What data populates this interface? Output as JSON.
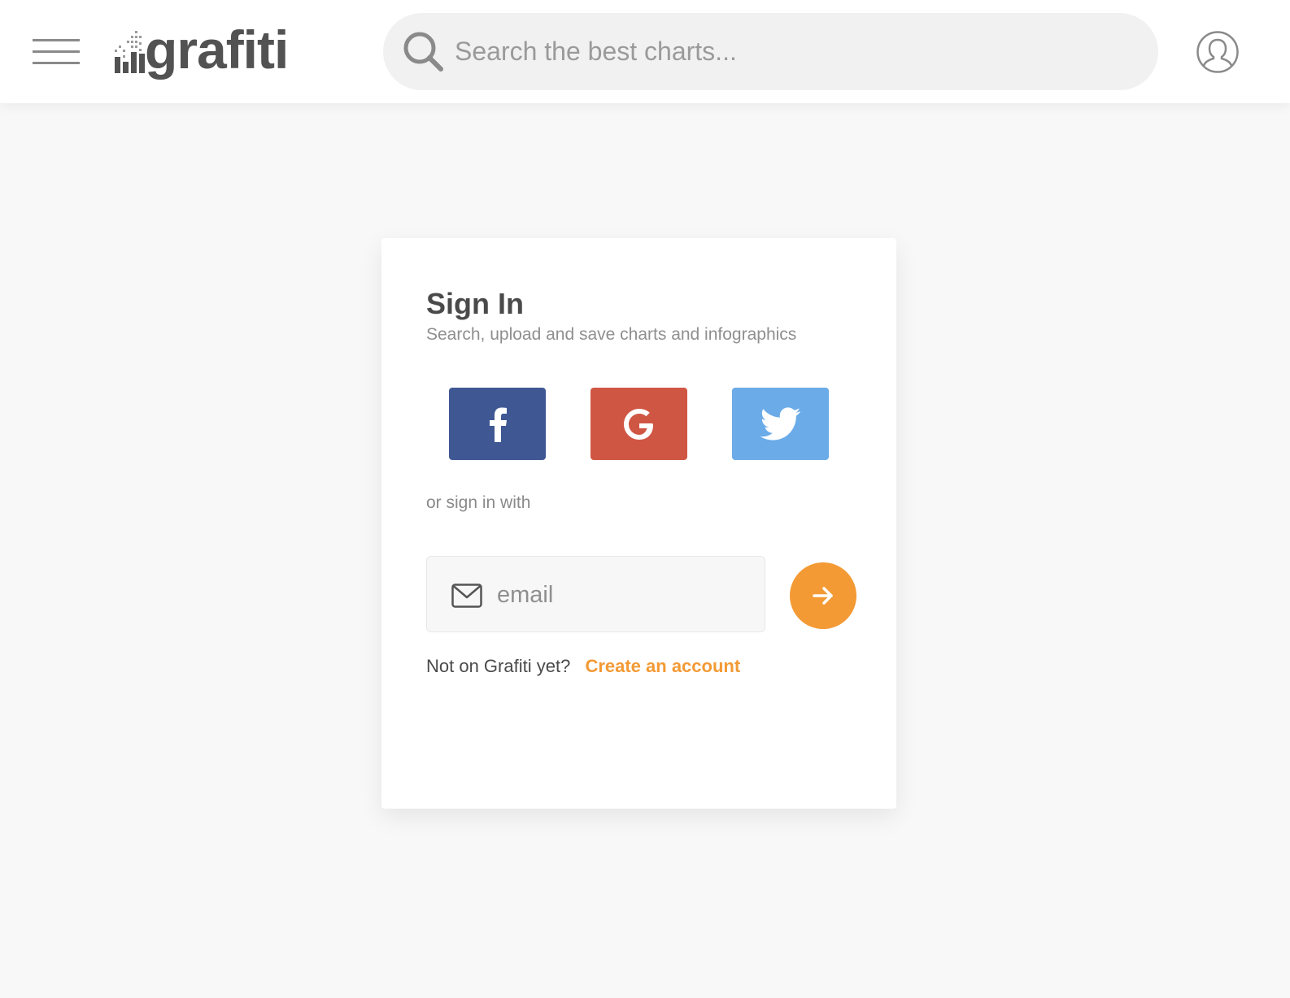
{
  "header": {
    "logo_text": "grafiti",
    "search": {
      "placeholder": "Search the best charts..."
    }
  },
  "signin": {
    "title": "Sign In",
    "subtitle": "Search, upload and save charts and infographics",
    "social": [
      {
        "name": "facebook",
        "icon": "facebook-icon",
        "color": "#3f5894"
      },
      {
        "name": "google",
        "icon": "google-icon",
        "color": "#d05644"
      },
      {
        "name": "twitter",
        "icon": "twitter-icon",
        "color": "#6aabe8"
      }
    ],
    "or_text": "or sign in with",
    "email": {
      "placeholder": "email"
    },
    "submit_icon": "arrow-right-icon",
    "prompt": "Not on Grafiti yet?",
    "create_link": "Create an account"
  },
  "colors": {
    "accent": "#f39a35",
    "background": "#f8f8f8",
    "card": "#ffffff",
    "text": "#4a4a4a"
  }
}
